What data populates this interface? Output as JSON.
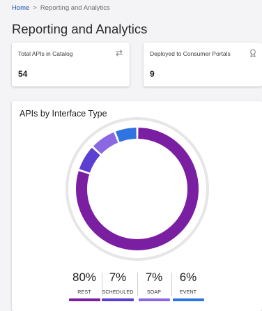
{
  "breadcrumb": {
    "home": "Home",
    "separator": ">",
    "current": "Reporting and Analytics"
  },
  "page": {
    "title": "Reporting and Analytics"
  },
  "kpis": [
    {
      "label": "Total APIs in Catalog",
      "value": "54",
      "icon": "swap-arrows-icon"
    },
    {
      "label": "Deployed to Consumer Portals",
      "value": "9",
      "icon": "award-ribbon-icon"
    }
  ],
  "chart_card": {
    "title": "APIs by Interface Type"
  },
  "chart_data": {
    "type": "pie",
    "style": "donut",
    "title": "APIs by Interface Type",
    "categories": [
      "REST",
      "SCHEDULED",
      "SOAP",
      "EVENT"
    ],
    "values": [
      80,
      7,
      7,
      6
    ],
    "value_labels": [
      "80%",
      "7%",
      "7%",
      "6%"
    ],
    "colors": [
      "#7b1fa2",
      "#5a3fd2",
      "#8a68e2",
      "#2f74e0"
    ],
    "legend": "bottom"
  }
}
